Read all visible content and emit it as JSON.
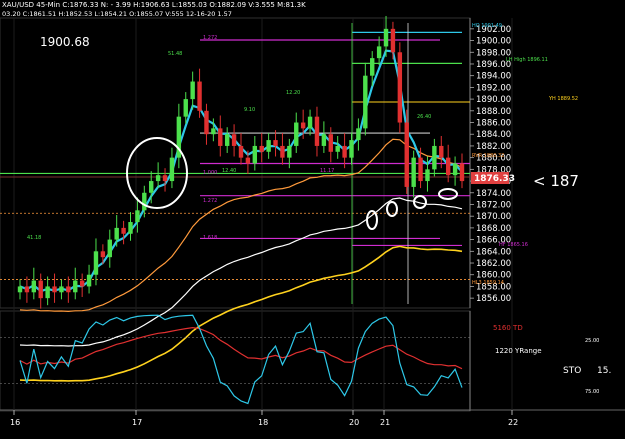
{
  "header": {
    "line1": "XAU/USD 45-Min  C:1876.33  N: - 3.99  H:1906.63  L:1855.03  O:1882.09  V:3.555  M:81.3K",
    "line2": "03.20  C:1861.51  H:1852.53  L:1854.21  O:1855.07  V:555  12-16-20  1.57"
  },
  "chart_data": [
    {
      "type": "candlestick",
      "price_axis_ticks": [
        "1856.00",
        "1858.00",
        "1860.00",
        "1862.00",
        "1864.00",
        "1866.00",
        "1868.00",
        "1870.00",
        "1872.00",
        "1874.00",
        "1876.00",
        "1878.00",
        "1880.00",
        "1882.00",
        "1884.00",
        "1886.00",
        "1888.00",
        "1890.00",
        "1892.00",
        "1894.00",
        "1896.00",
        "1898.00",
        "1900.00",
        "1902.00"
      ],
      "ylim": [
        1855,
        1903
      ],
      "x_ticks": [
        "16",
        "17",
        "18",
        "20",
        "21",
        "22"
      ],
      "last_price_label": "1876.33",
      "annotations": {
        "big_label": "1900.68",
        "arrow_label": "< 187",
        "hi": "HO 1901.49",
        "lh": "LH High 1896.11",
        "yh": "YH 1889.52",
        "rvr": "RVR 1880.32",
        "hf": "HF 1865.16",
        "hl3": "HL3 1859.14",
        "small": [
          "51.48",
          "9.10",
          "12.20",
          "26.40",
          "12.40",
          "11.17",
          "41.18",
          "1.272",
          "1.000",
          "1.272",
          "1.618"
        ]
      },
      "closes": [
        1858,
        1857,
        1859,
        1856,
        1858,
        1857,
        1858,
        1857,
        1859,
        1858,
        1860,
        1864,
        1863,
        1866,
        1868,
        1867,
        1869,
        1871,
        1874,
        1876,
        1877,
        1876,
        1880,
        1887,
        1890,
        1893,
        1888,
        1884,
        1885,
        1882,
        1884,
        1882,
        1880,
        1879,
        1882,
        1881,
        1883,
        1882,
        1880,
        1882,
        1886,
        1885,
        1887,
        1882,
        1884,
        1881,
        1882,
        1880,
        1883,
        1885,
        1894,
        1897,
        1899,
        1902,
        1898,
        1886,
        1875,
        1880,
        1876,
        1878,
        1882,
        1880,
        1877,
        1879,
        1876
      ],
      "series": [
        {
          "name": "ema_fast",
          "color": "#2ec8e8"
        },
        {
          "name": "ema_slow",
          "color": "#ff9a3c"
        },
        {
          "name": "ma_white",
          "color": "#ffffff"
        },
        {
          "name": "ma_yellow",
          "color": "#ffd21e"
        }
      ]
    },
    {
      "type": "line",
      "series": [
        {
          "name": "5160 TD",
          "color": "#e03030"
        },
        {
          "name": "1220 YRange",
          "color": "#2ec8e8"
        }
      ],
      "label_td": "5160 TD",
      "label_yr": "1220 YRange",
      "label_sto": "STO",
      "sto_value": "15.",
      "axis_ticks": [
        "25.00",
        "75.00"
      ]
    }
  ]
}
